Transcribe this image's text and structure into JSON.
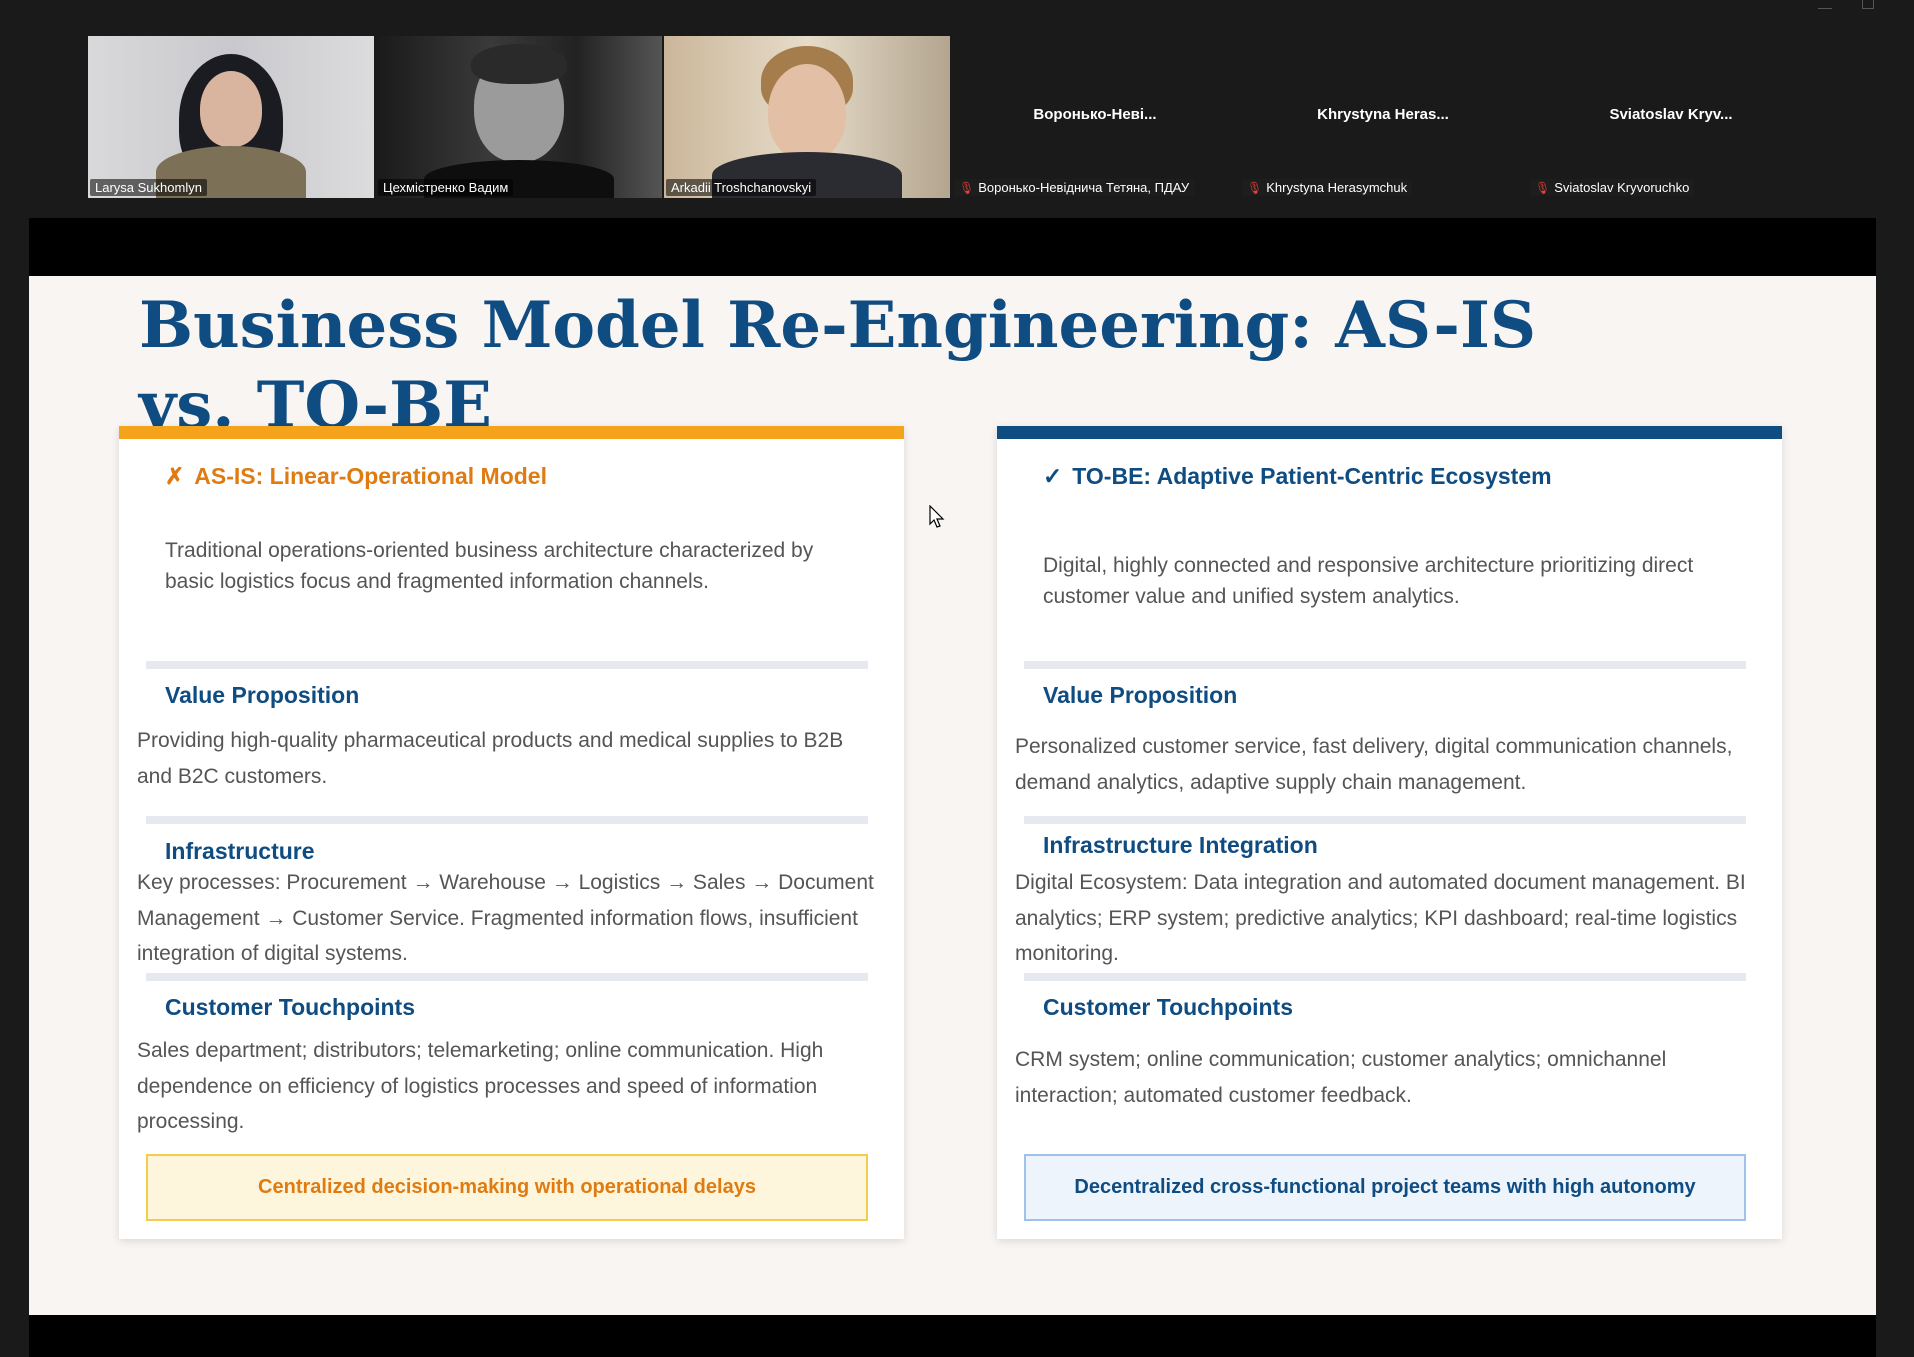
{
  "participants": [
    {
      "name": "Larysa Sukhomlyn",
      "video": true,
      "active": false
    },
    {
      "name": "Цехмістренко Вадим",
      "video": true,
      "active": true
    },
    {
      "name": "Arkadii Troshchanovskyi",
      "video": true,
      "active": false
    },
    {
      "name": "Воронько-Невіднича Тетяна, ПДАУ",
      "display": "Воронько-Неві...",
      "video": false,
      "muted": true
    },
    {
      "name": "Khrystyna Herasymchuk",
      "display": "Khrystyna Heras...",
      "video": false,
      "muted": true
    },
    {
      "name": "Sviatoslav Kryvoruchko",
      "display": "Sviatoslav Kryv...",
      "video": false,
      "muted": true
    }
  ],
  "slide": {
    "title": "Business Model Re-Engineering: AS-IS vs. TO-BE",
    "left": {
      "mark": "✗",
      "heading": "AS-IS: Linear-Operational Model",
      "intro": "Traditional operations-oriented business architecture characterized by basic logistics focus and fragmented information channels.",
      "sections": [
        {
          "title": "Value Proposition",
          "text": "Providing high-quality pharmaceutical products and medical supplies to B2B and B2C customers."
        },
        {
          "title": "Infrastructure",
          "text": "Key processes: Procurement → Warehouse → Logistics → Sales → Document Management → Customer Service. Fragmented information flows, insufficient integration of digital systems."
        },
        {
          "title": "Customer Touchpoints",
          "text": "Sales department; distributors; telemarketing; online communication. High dependence on efficiency of logistics processes and speed of information processing."
        }
      ],
      "footer": "Centralized decision-making with operational delays"
    },
    "right": {
      "mark": "✓",
      "heading": "TO-BE: Adaptive Patient-Centric Ecosystem",
      "intro": "Digital, highly connected and responsive architecture prioritizing direct customer value and unified system analytics.",
      "sections": [
        {
          "title": "Value Proposition",
          "text": "Personalized customer service, fast delivery, digital communication channels, demand analytics, adaptive supply chain management."
        },
        {
          "title": "Infrastructure Integration",
          "text": "Digital Ecosystem: Data integration and automated document management. BI analytics; ERP system; predictive analytics; KPI dashboard; real-time logistics monitoring."
        },
        {
          "title": "Customer Touchpoints",
          "text": "CRM system; online communication; customer analytics; omnichannel interaction; automated customer feedback."
        }
      ],
      "footer": "Decentralized cross-functional project teams with high autonomy"
    }
  },
  "colors": {
    "accent_orange": "#f5a31a",
    "accent_blue": "#0f4c81",
    "active_speaker": "#23d18b"
  }
}
